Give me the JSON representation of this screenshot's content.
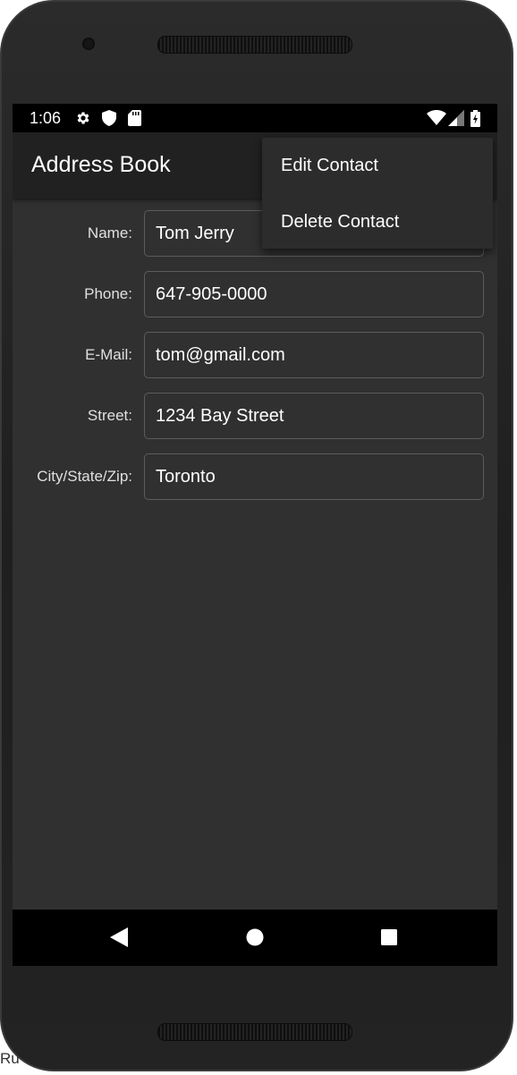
{
  "status_bar": {
    "time": "1:06",
    "left_icons": [
      "gear-icon",
      "shield-icon",
      "sd-card-icon"
    ],
    "right_icons": [
      "wifi-icon",
      "signal-icon",
      "battery-charging-icon"
    ]
  },
  "app_bar": {
    "title": "Address Book"
  },
  "overflow_menu": {
    "items": [
      {
        "label": "Edit Contact"
      },
      {
        "label": "Delete Contact"
      }
    ]
  },
  "form": {
    "fields": [
      {
        "label": "Name:",
        "value": "Tom Jerry"
      },
      {
        "label": "Phone:",
        "value": "647-905-0000"
      },
      {
        "label": "E-Mail:",
        "value": "tom@gmail.com"
      },
      {
        "label": "Street:",
        "value": "1234 Bay Street"
      },
      {
        "label": "City/State/Zip:",
        "value": "Toronto"
      }
    ]
  },
  "nav_bar": {
    "buttons": [
      "back-icon",
      "home-icon",
      "recents-icon"
    ]
  },
  "corner_fragment": "Ru",
  "colors": {
    "screen_background": "#303030",
    "app_bar": "#212121",
    "status_bar": "#000000",
    "menu_background": "#2c2c2c",
    "input_border": "#5c5c5c"
  }
}
